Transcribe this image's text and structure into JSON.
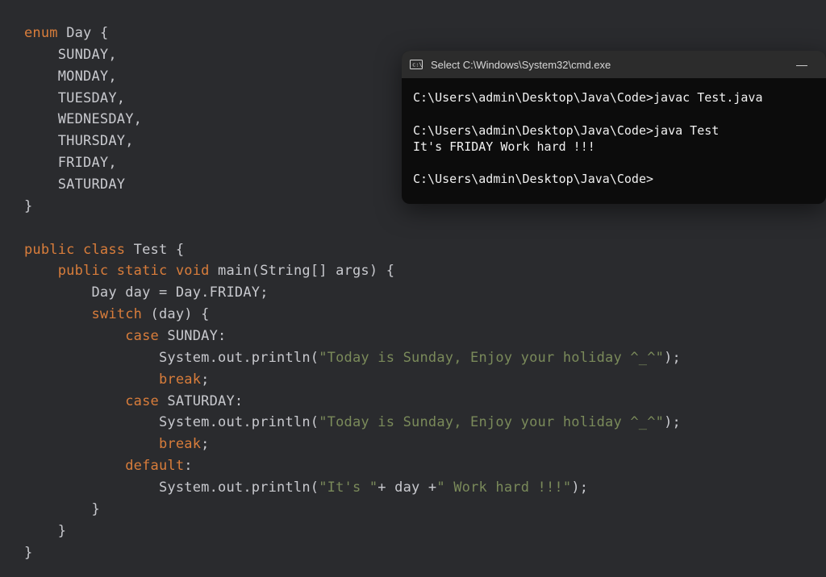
{
  "code": {
    "enum_kw": "enum",
    "enum_name": "Day",
    "members": {
      "SUNDAY": "SUNDAY",
      "MONDAY": "MONDAY",
      "TUESDAY": "TUESDAY",
      "WEDNESDAY": "WEDNESDAY",
      "THURSDAY": "THURSDAY",
      "FRIDAY": "FRIDAY",
      "SATURDAY": "SATURDAY"
    },
    "public_kw": "public",
    "class_kw": "class",
    "class_name": "Test",
    "static_kw": "static",
    "void_kw": "void",
    "main_name": "main",
    "main_params": "(String[] args)",
    "day_decl_type": "Day",
    "day_decl_name": "day",
    "equals": "=",
    "day_decl_value": "Day.FRIDAY",
    "semicolon": ";",
    "switch_kw": "switch",
    "switch_expr": "(day)",
    "case_kw": "case",
    "colon": ":",
    "system_out_println": "System.out.println",
    "str_sunday1": "\"Today is Sunday, Enjoy your holiday ^_^\"",
    "str_sunday2": "\"Today is Sunday, Enjoy your holiday ^_^\"",
    "break_kw": "break",
    "default_kw": "default",
    "str_its": "\"It's \"",
    "plus": "+",
    "day_var": " day ",
    "str_workhard": "\" Work hard !!!\"",
    "lbrace": "{",
    "rbrace": "}",
    "lparen": "(",
    "rparen": ")",
    "comma": ","
  },
  "terminal": {
    "title": "Select C:\\Windows\\System32\\cmd.exe",
    "line1": "C:\\Users\\admin\\Desktop\\Java\\Code>javac Test.java",
    "line2": "C:\\Users\\admin\\Desktop\\Java\\Code>java Test",
    "line3": "It's FRIDAY Work hard !!!",
    "line4": "C:\\Users\\admin\\Desktop\\Java\\Code>",
    "minimize": "—"
  }
}
